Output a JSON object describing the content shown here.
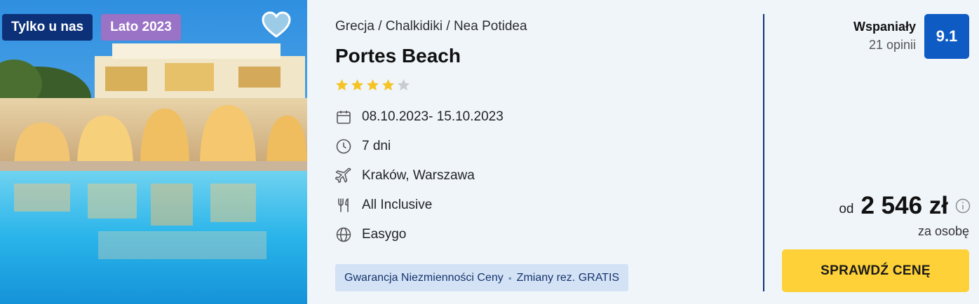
{
  "photo": {
    "badges": [
      "Tylko u nas",
      "Lato 2023"
    ],
    "favorite_icon": "heart-icon"
  },
  "hotel": {
    "breadcrumb": "Grecja / Chalkidiki / Nea Potidea",
    "name": "Portes Beach",
    "stars": 4,
    "stars_max": 5
  },
  "details": [
    {
      "icon": "calendar-icon",
      "text": "08.10.2023- 15.10.2023"
    },
    {
      "icon": "clock-icon",
      "text": "7 dni"
    },
    {
      "icon": "plane-icon",
      "text": "Kraków, Warszawa"
    },
    {
      "icon": "cutlery-icon",
      "text": "All Inclusive"
    },
    {
      "icon": "globe-icon",
      "text": "Easygo"
    }
  ],
  "guarantee": {
    "left": "Gwarancja Niezmienności Ceny",
    "separator": "•",
    "right": "Zmiany rez. GRATIS"
  },
  "rating": {
    "word": "Wspaniały",
    "count": "21 opinii",
    "score": "9.1"
  },
  "price": {
    "from": "od",
    "value": "2 546 zł",
    "per": "za osobę"
  },
  "cta": {
    "label": "SPRAWDŹ CENĘ"
  },
  "colors": {
    "navy": "#0d3179",
    "accent_blue": "#0e5bc4",
    "cta_yellow": "#fdd137",
    "star": "#f6c324"
  }
}
